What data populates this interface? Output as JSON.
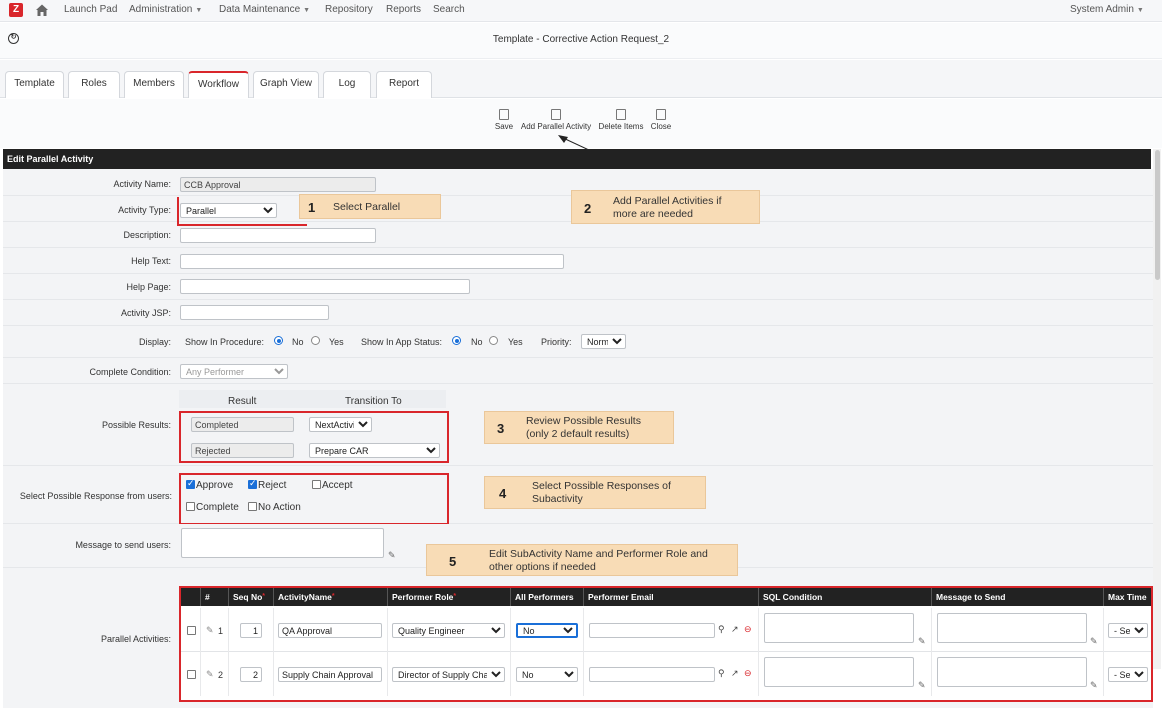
{
  "nav": {
    "logo": "Z",
    "items": [
      "Launch Pad",
      "Administration",
      "Data Maintenance",
      "Repository",
      "Reports",
      "Search"
    ],
    "user": "System Admin"
  },
  "page": {
    "title": "Template - Corrective Action Request_2"
  },
  "tabs": [
    "Template",
    "Roles",
    "Members",
    "Workflow",
    "Graph View",
    "Log",
    "Report"
  ],
  "toolbar": {
    "save": "Save",
    "add": "Add Parallel Activity",
    "delete": "Delete Items",
    "close": "Close"
  },
  "section": {
    "title": "Edit Parallel Activity"
  },
  "form": {
    "activity_name_label": "Activity Name:",
    "activity_name": "CCB Approval",
    "activity_type_label": "Activity Type:",
    "activity_type": "Parallel",
    "description_label": "Description:",
    "help_text_label": "Help Text:",
    "help_page_label": "Help Page:",
    "activity_jsp_label": "Activity JSP:",
    "display_label": "Display:",
    "show_in_procedure": "Show In Procedure:",
    "show_in_app_status": "Show In App Status:",
    "no": "No",
    "yes": "Yes",
    "priority_label": "Priority:",
    "priority": "Normal",
    "complete_condition_label": "Complete Condition:",
    "complete_condition": "Any Performer",
    "possible_results_label": "Possible Results:",
    "result_header": "Result",
    "transition_header": "Transition To",
    "result1": "Completed",
    "transition1": "NextActivity",
    "result2": "Rejected",
    "transition2": "Prepare CAR",
    "responses_label": "Select Possible Response from users:",
    "resp_approve": "Approve",
    "resp_reject": "Reject",
    "resp_accept": "Accept",
    "resp_complete": "Complete",
    "resp_noaction": "No Action",
    "message_label": "Message to send users:",
    "parallel_label": "Parallel Activities:"
  },
  "grid": {
    "headers": [
      "#",
      "Seq No",
      "ActivityName",
      "Performer Role",
      "All Performers",
      "Performer Email",
      "SQL Condition",
      "Message to Send",
      "Max Time"
    ],
    "rows": [
      {
        "num": "1",
        "seq": "1",
        "name": "QA Approval",
        "role": "Quality Engineer",
        "all": "No",
        "maxtime": "- Sel -"
      },
      {
        "num": "2",
        "seq": "2",
        "name": "Supply Chain Approval",
        "role": "Director of Supply Chain",
        "all": "No",
        "maxtime": "- Sel -"
      }
    ]
  },
  "callouts": [
    {
      "num": "1",
      "text": "Select Parallel"
    },
    {
      "num": "2",
      "text_line1": "Add Parallel Activities if",
      "text_line2": "more are needed"
    },
    {
      "num": "3",
      "text_line1": "Review Possible Results",
      "text_line2": "(only 2 default results)"
    },
    {
      "num": "4",
      "text_line1": "Select Possible Responses of",
      "text_line2": "Subactivity"
    },
    {
      "num": "5",
      "text_line1": "Edit SubActivity Name and Performer Role and",
      "text_line2": "other options if needed"
    }
  ],
  "colors": {
    "accent": "#d9262b",
    "callout": "#f8dcb6",
    "header": "#222222",
    "radio": "#1a6fd8"
  }
}
